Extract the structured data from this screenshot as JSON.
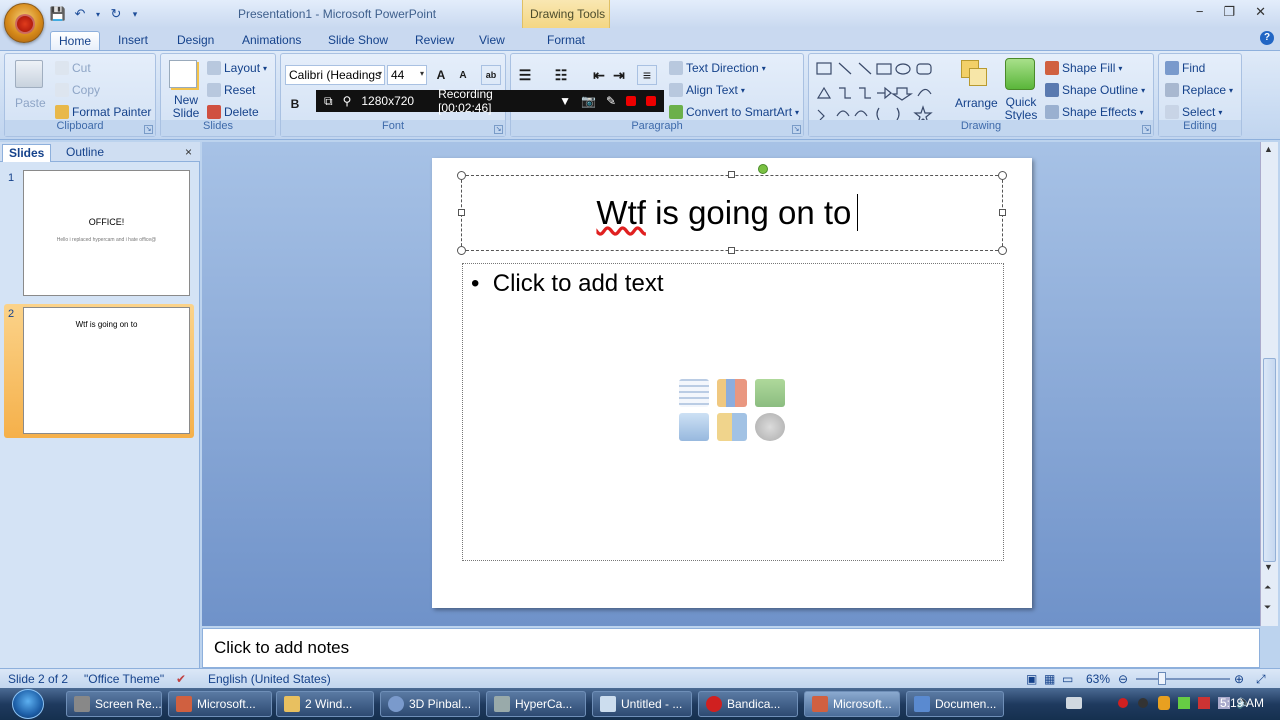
{
  "window": {
    "title": "Presentation1 - Microsoft PowerPoint",
    "context_group": "Drawing Tools",
    "minimize_glyph": "−",
    "restore_glyph": "❐",
    "close_glyph": "✕",
    "help_glyph": "?"
  },
  "tabs": [
    "Home",
    "Insert",
    "Design",
    "Animations",
    "Slide Show",
    "Review",
    "View",
    "Format"
  ],
  "ribbon": {
    "clipboard": {
      "label": "Clipboard",
      "paste": "Paste",
      "cut": "Cut",
      "copy": "Copy",
      "format_painter": "Format Painter"
    },
    "slides": {
      "label": "Slides",
      "new_slide": "New Slide",
      "layout": "Layout",
      "reset": "Reset",
      "delete": "Delete"
    },
    "font": {
      "label": "Font",
      "font_name": "Calibri (Headings",
      "font_size": "44",
      "bold": "B"
    },
    "paragraph": {
      "label": "Paragraph",
      "text_direction": "Text Direction",
      "align_text": "Align Text",
      "convert_smartart": "Convert to SmartArt"
    },
    "drawing": {
      "label": "Drawing",
      "arrange": "Arrange",
      "quick_styles": "Quick Styles",
      "shape_fill": "Shape Fill",
      "shape_outline": "Shape Outline",
      "shape_effects": "Shape Effects"
    },
    "editing": {
      "label": "Editing",
      "find": "Find",
      "replace": "Replace",
      "select": "Select"
    }
  },
  "recorder": {
    "resolution": "1280x720",
    "status": "Recording [00:02:46]"
  },
  "left_pane": {
    "tabs": [
      "Slides",
      "Outline"
    ],
    "close_glyph": "×",
    "slides": [
      {
        "number": "1",
        "title": "OFFICE!",
        "subtitle": "Hello i replaced hypercam and i hate office@"
      },
      {
        "number": "2",
        "title": "Wtf is going on to",
        "subtitle": ""
      }
    ]
  },
  "slide": {
    "title": "Wtf is going on to",
    "title_misspelled": "Wtf",
    "title_rest": " is going on to",
    "bullet": "•",
    "body_placeholder": "Click to add text"
  },
  "notes": {
    "placeholder": "Click to add notes"
  },
  "statusbar": {
    "slide": "Slide 2 of 2",
    "theme": "\"Office Theme\"",
    "language": "English (United States)",
    "zoom": "63%",
    "zoom_fraction": 0.28
  },
  "taskbar": {
    "items": [
      "Screen Re...",
      "Microsoft...",
      "2 Wind...",
      "3D Pinbal...",
      "HyperCa...",
      "Untitled - ...",
      "Bandica...",
      "Microsoft...",
      "Documen..."
    ],
    "clock": "5:19 AM"
  },
  "colors": {
    "ribbon": "#dfeaf8",
    "accent": "#15428b",
    "canvas": "#6f92c9",
    "active_thumb": "#f5b04a"
  }
}
